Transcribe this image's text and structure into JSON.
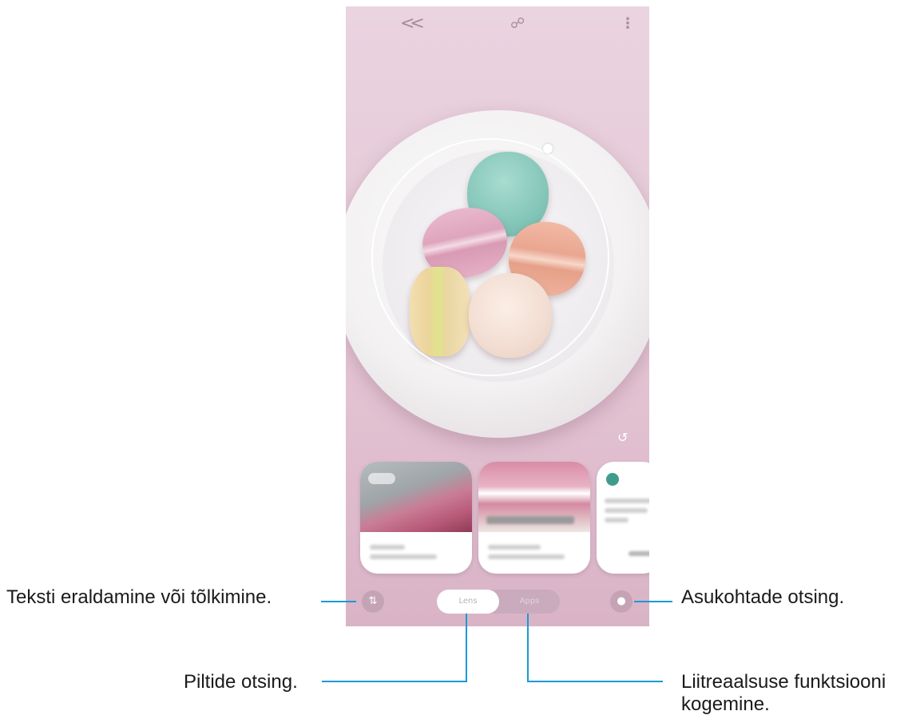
{
  "topbar": {
    "back_icon": "back-chevron-icon",
    "bixby_icon": "bixby-vision-icon",
    "more_icon": "more-vertical-icon"
  },
  "modes": {
    "lens": "Lens",
    "apps": "Apps"
  },
  "buttons": {
    "text_icon": "text-translate-icon",
    "place_icon": "location-pin-icon",
    "refresh_icon": "refresh-icon"
  },
  "callouts": {
    "text": "Teksti eraldamine või tõlkimine.",
    "place": "Asukohtade otsing.",
    "image": "Piltide otsing.",
    "ar_line1": "Liitreaalsuse funktsiooni",
    "ar_line2": "kogemine."
  },
  "colors": {
    "callout_line": "#1a9ad6",
    "screen_background": "#e4c5d4"
  }
}
